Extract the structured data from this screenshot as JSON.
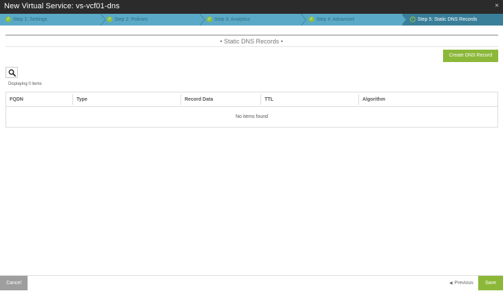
{
  "header": {
    "title": "New Virtual Service: vs-vcf01-dns",
    "close_label": "×"
  },
  "wizard": {
    "steps": [
      {
        "label": "Step 1: Settings",
        "state": "complete"
      },
      {
        "label": "Step 2: Policies",
        "state": "complete"
      },
      {
        "label": "Step 3: Analytics",
        "state": "complete"
      },
      {
        "label": "Step 4: Advanced",
        "state": "complete"
      },
      {
        "label": "Step 5: Static DNS Records",
        "state": "active"
      }
    ],
    "check_glyph": "✓"
  },
  "section": {
    "title": "• Static DNS Records •"
  },
  "toolbar": {
    "create_label": "Create DNS Record",
    "search_icon": "search-icon"
  },
  "list": {
    "count_text": "Displaying 0 items",
    "columns": [
      "FQDN",
      "Type",
      "Record Data",
      "TTL",
      "Algorithm"
    ],
    "empty_text": "No items found"
  },
  "footer": {
    "cancel_label": "Cancel",
    "previous_label": "Previous",
    "save_label": "Save"
  },
  "colors": {
    "header_bg": "#2b2b2b",
    "wizard_bg": "#5aa9c6",
    "wizard_active_bg": "#3a7f9a",
    "accent_green": "#8cb83a",
    "cancel_gray": "#9e9e9e"
  }
}
